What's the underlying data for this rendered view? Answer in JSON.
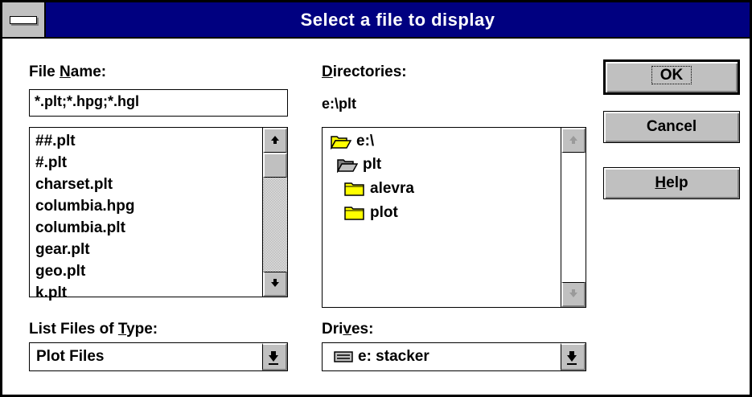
{
  "window": {
    "title": "Select a file to display"
  },
  "file_name": {
    "label_prefix": "File ",
    "label_mnemonic": "N",
    "label_suffix": "ame:",
    "value": "*.plt;*.hpg;*.hgl"
  },
  "files": {
    "items": [
      "##.plt",
      "#.plt",
      "charset.plt",
      "columbia.hpg",
      "columbia.plt",
      "gear.plt",
      "geo.plt",
      "k.plt"
    ]
  },
  "directories": {
    "label_mnemonic": "D",
    "label_suffix": "irectories:",
    "current_path": "e:\\plt",
    "items": [
      {
        "name": "e:\\",
        "icon": "open-folder-icon"
      },
      {
        "name": "plt",
        "icon": "open-folder-icon"
      },
      {
        "name": "alevra",
        "icon": "folder-icon"
      },
      {
        "name": "plot",
        "icon": "folder-icon"
      }
    ]
  },
  "file_type": {
    "label_prefix": "List Files of ",
    "label_mnemonic": "T",
    "label_suffix": "ype:",
    "value": "Plot Files"
  },
  "drives": {
    "label_prefix": "Dri",
    "label_mnemonic": "v",
    "label_suffix": "es:",
    "value": "e: stacker",
    "icon": "drive-icon"
  },
  "buttons": {
    "ok": "OK",
    "cancel": "Cancel",
    "help_mnemonic": "H",
    "help_suffix": "elp"
  },
  "colors": {
    "titlebar": "#000080",
    "face": "#c0c0c0",
    "folder_fill": "#ffff00"
  }
}
